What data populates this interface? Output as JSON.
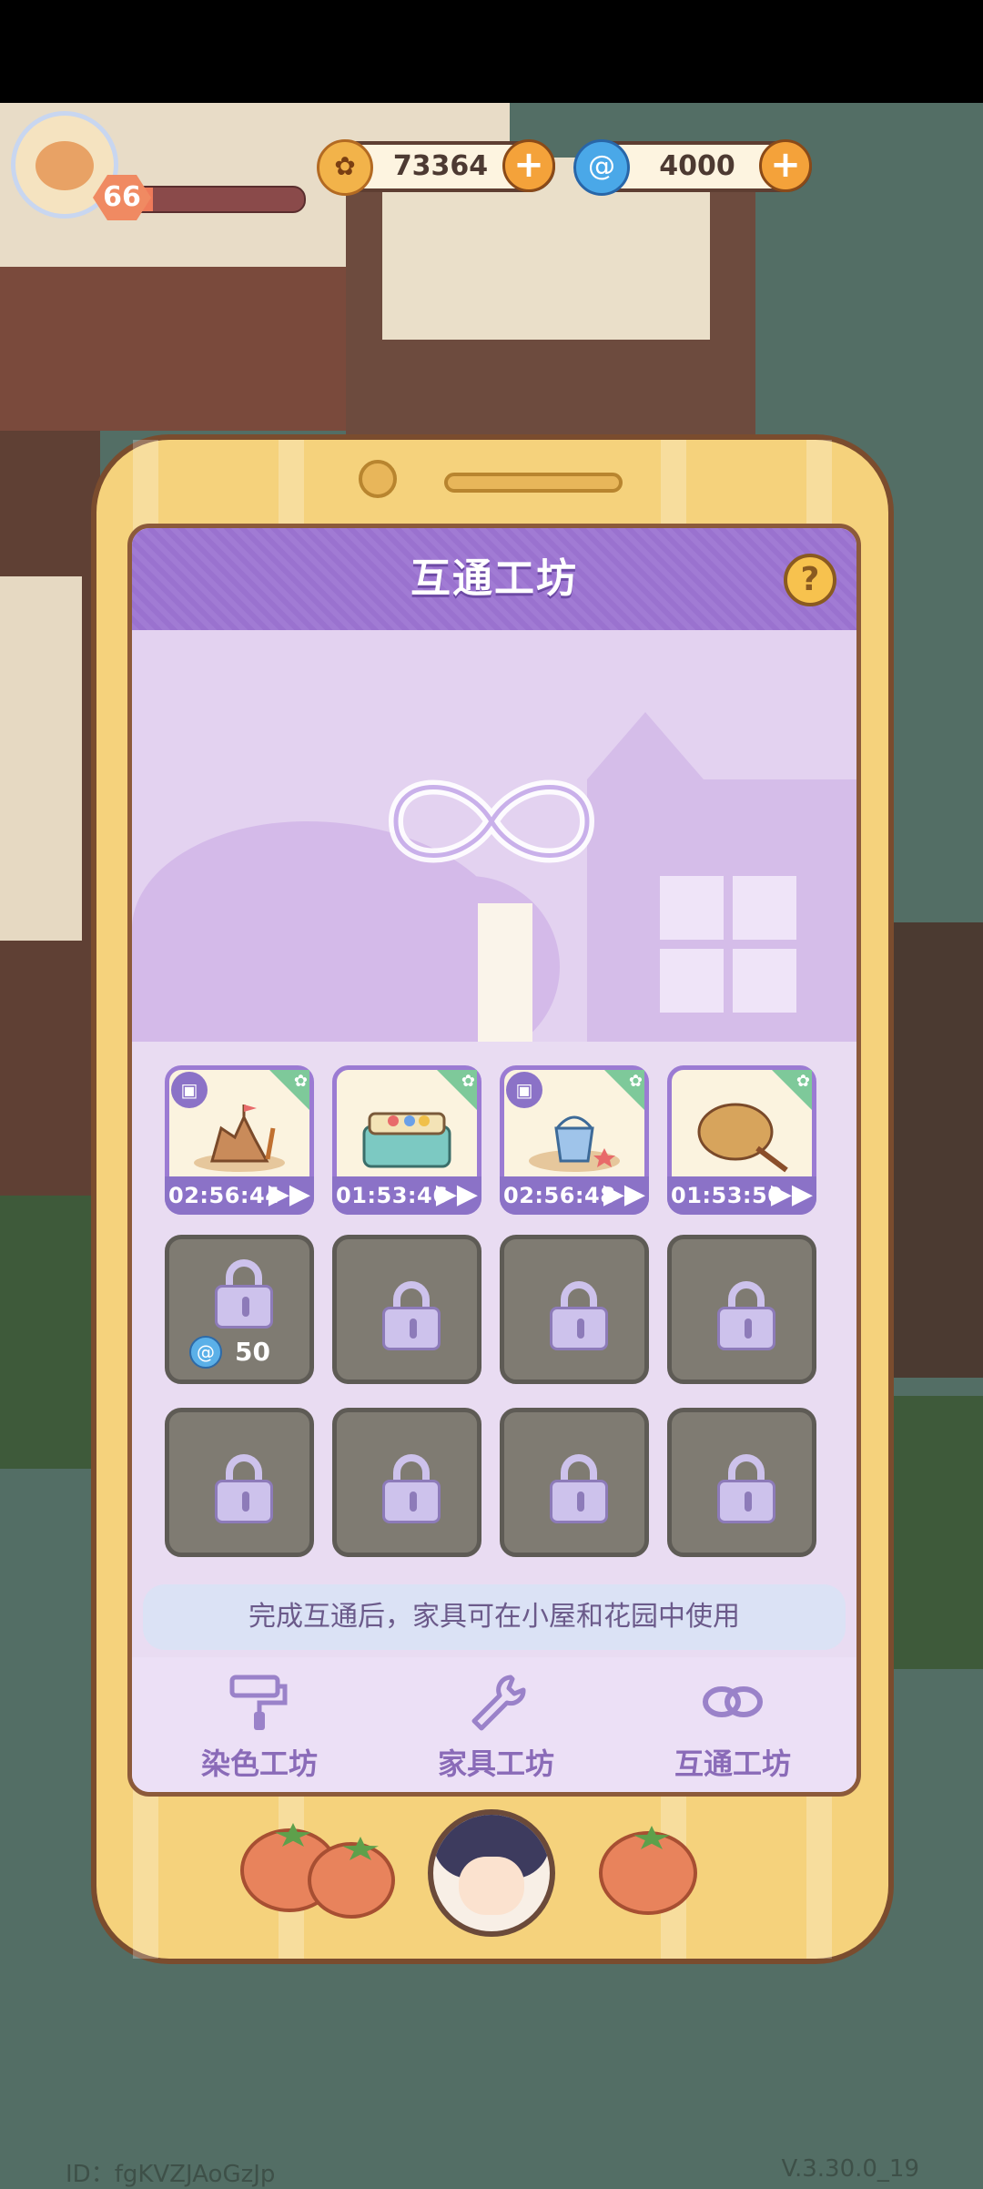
{
  "hud": {
    "level": "66",
    "xp_fraction": 0.08,
    "coins": "73364",
    "gems": "4000"
  },
  "workshop": {
    "title": "互通工坊",
    "help_label": "?",
    "slots_active": [
      {
        "item_icon": "sandcastle-icon",
        "timer": "02:56:44"
      },
      {
        "item_icon": "toolbox-icon",
        "timer": "01:53:46"
      },
      {
        "item_icon": "sand-bucket-icon",
        "timer": "02:56:48"
      },
      {
        "item_icon": "fan-icon",
        "timer": "01:53:50"
      }
    ],
    "unlock_cost": "50",
    "note": "完成互通后，家具可在小屋和花园中使用"
  },
  "tabs": [
    {
      "label": "染色工坊",
      "icon": "paint-roller-icon"
    },
    {
      "label": "家具工坊",
      "icon": "wrench-icon"
    },
    {
      "label": "互通工坊",
      "icon": "link-icon"
    }
  ],
  "footer": {
    "id": "ID：fgKVZJAoGzJp",
    "version": "V.3.30.0_19"
  },
  "colors": {
    "accent_purple": "#9a72cf",
    "phone_gold": "#f5d27c",
    "locked_gray": "#7f7b72"
  }
}
